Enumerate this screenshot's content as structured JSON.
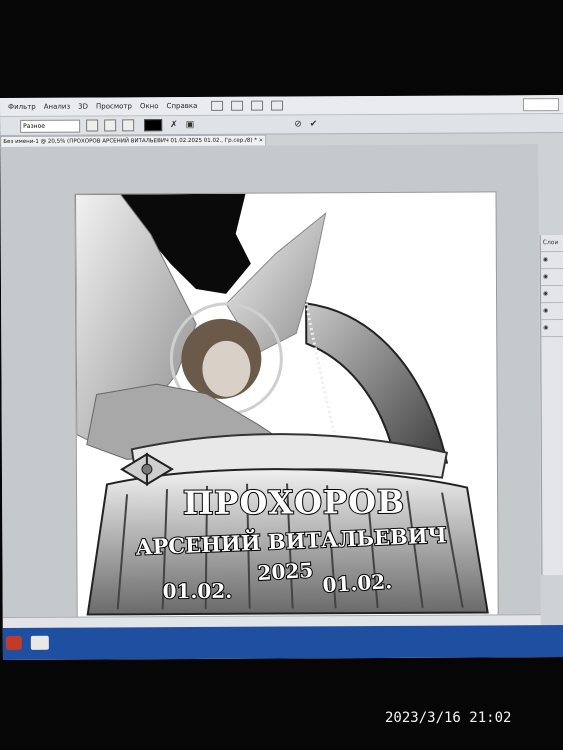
{
  "menubar": {
    "items": [
      "Фильтр",
      "Анализ",
      "3D",
      "Просмотр",
      "Окно",
      "Справка"
    ]
  },
  "options": {
    "mode": "Разное"
  },
  "document": {
    "tab_title": "Без имени-1 @ 20,5% (ПРОХОРОВ АРСЕНИЙ ВИТАЛЬЕВИЧ 01.02.2025 01.02., Гр.сер./8) *",
    "close": "×"
  },
  "canvas": {
    "surname": "ПРОХОРОВ",
    "name": "АРСЕНИЙ ВИТАЛЬЕВИЧ",
    "year": "2025",
    "date_left": "01.02.",
    "date_right": "01.02."
  },
  "photo": {
    "timestamp": "2023/3/16 21:02"
  }
}
